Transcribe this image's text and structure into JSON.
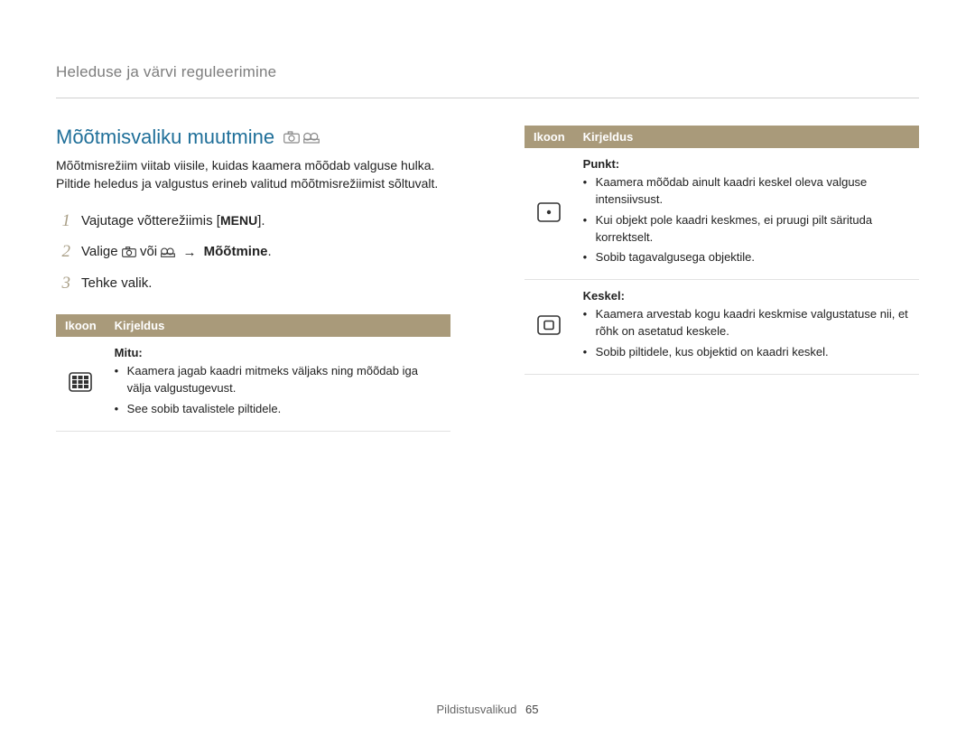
{
  "breadcrumb": "Heleduse ja värvi reguleerimine",
  "section_title": "Mõõtmisvaliku muutmine",
  "body_text": "Mõõtmisrežiim viitab viisile, kuidas kaamera mõõdab valguse hulka. Piltide heledus ja valgustus erineb valitud mõõtmisrežiimist sõltuvalt.",
  "steps": {
    "s1": {
      "num": "1",
      "prefix": "Vajutage võtterežiimis [",
      "menu": "MENU",
      "suffix": "]."
    },
    "s2": {
      "num": "2",
      "prefix": "Valige ",
      "mid": " või ",
      "rest": "Mõõtmine",
      "period": "."
    },
    "s3": {
      "num": "3",
      "text": "Tehke valik."
    }
  },
  "table_left": {
    "h1": "Ikoon",
    "h2": "Kirjeldus",
    "row1": {
      "label": "Mitu:",
      "b1": "Kaamera jagab kaadri mitmeks väljaks ning mõõdab iga välja valgustugevust.",
      "b2": "See sobib tavalistele piltidele."
    }
  },
  "table_right": {
    "h1": "Ikoon",
    "h2": "Kirjeldus",
    "row1": {
      "label": "Punkt:",
      "b1": "Kaamera mõõdab ainult kaadri keskel oleva valguse intensiivsust.",
      "b2": "Kui objekt pole kaadri keskmes, ei pruugi pilt särituda korrektselt.",
      "b3": "Sobib tagavalgusega objektile."
    },
    "row2": {
      "label": "Keskel:",
      "b1": "Kaamera arvestab kogu kaadri keskmise valgustatuse nii, et rõhk on asetatud keskele.",
      "b2": "Sobib piltidele, kus objektid on kaadri keskel."
    }
  },
  "footer": {
    "section": "Pildistusvalikud",
    "page": "65"
  }
}
